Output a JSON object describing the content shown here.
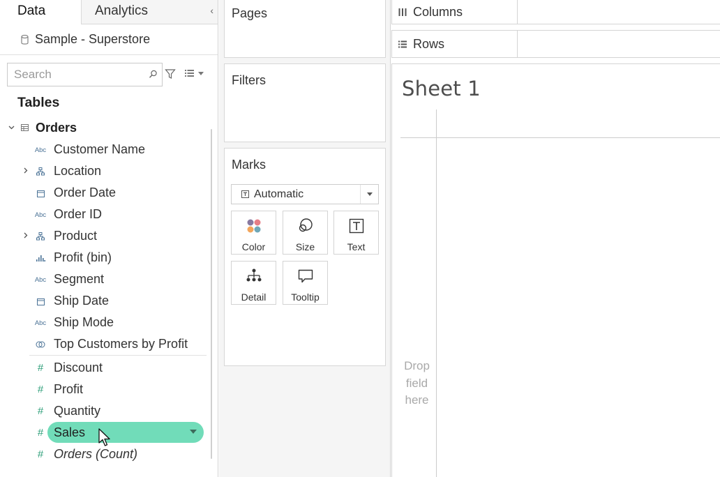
{
  "tabs": {
    "data": "Data",
    "analytics": "Analytics"
  },
  "datasource": {
    "name": "Sample - Superstore"
  },
  "search": {
    "placeholder": "Search"
  },
  "tables_section": {
    "title": "Tables"
  },
  "table": {
    "name": "Orders"
  },
  "fields": [
    {
      "label": "Customer Name",
      "icon": "abc-string-icon"
    },
    {
      "label": "Location",
      "icon": "hierarchy-icon",
      "expandable": true
    },
    {
      "label": "Order Date",
      "icon": "calendar-icon"
    },
    {
      "label": "Order ID",
      "icon": "abc-string-icon"
    },
    {
      "label": "Product",
      "icon": "hierarchy-icon",
      "expandable": true
    },
    {
      "label": "Profit (bin)",
      "icon": "bin-histogram-icon"
    },
    {
      "label": "Segment",
      "icon": "abc-string-icon"
    },
    {
      "label": "Ship Date",
      "icon": "calendar-icon"
    },
    {
      "label": "Ship Mode",
      "icon": "abc-string-icon"
    },
    {
      "label": "Top Customers by Profit",
      "icon": "set-icon"
    }
  ],
  "measures": [
    {
      "label": "Discount",
      "icon": "number-icon"
    },
    {
      "label": "Profit",
      "icon": "number-icon"
    },
    {
      "label": "Quantity",
      "icon": "number-icon"
    },
    {
      "label": "Sales",
      "icon": "number-icon",
      "selected": true
    },
    {
      "label": "Orders (Count)",
      "icon": "number-icon",
      "italic": true
    }
  ],
  "icon_text": {
    "abc": "Abc",
    "hash": "#"
  },
  "cards": {
    "pages": "Pages",
    "filters": "Filters",
    "marks": "Marks"
  },
  "marks": {
    "type": "Automatic",
    "buttons": {
      "color": "Color",
      "size": "Size",
      "text": "Text",
      "detail": "Detail",
      "tooltip": "Tooltip"
    }
  },
  "shelves": {
    "columns": "Columns",
    "rows": "Rows"
  },
  "sheet": {
    "title": "Sheet 1",
    "drop_hint_lines": [
      "Drop",
      "field",
      "here"
    ]
  },
  "colors": {
    "selected_pill": "#71dcb9",
    "measure_icon": "#2f9f7a",
    "dimension_icon": "#4a7296"
  }
}
